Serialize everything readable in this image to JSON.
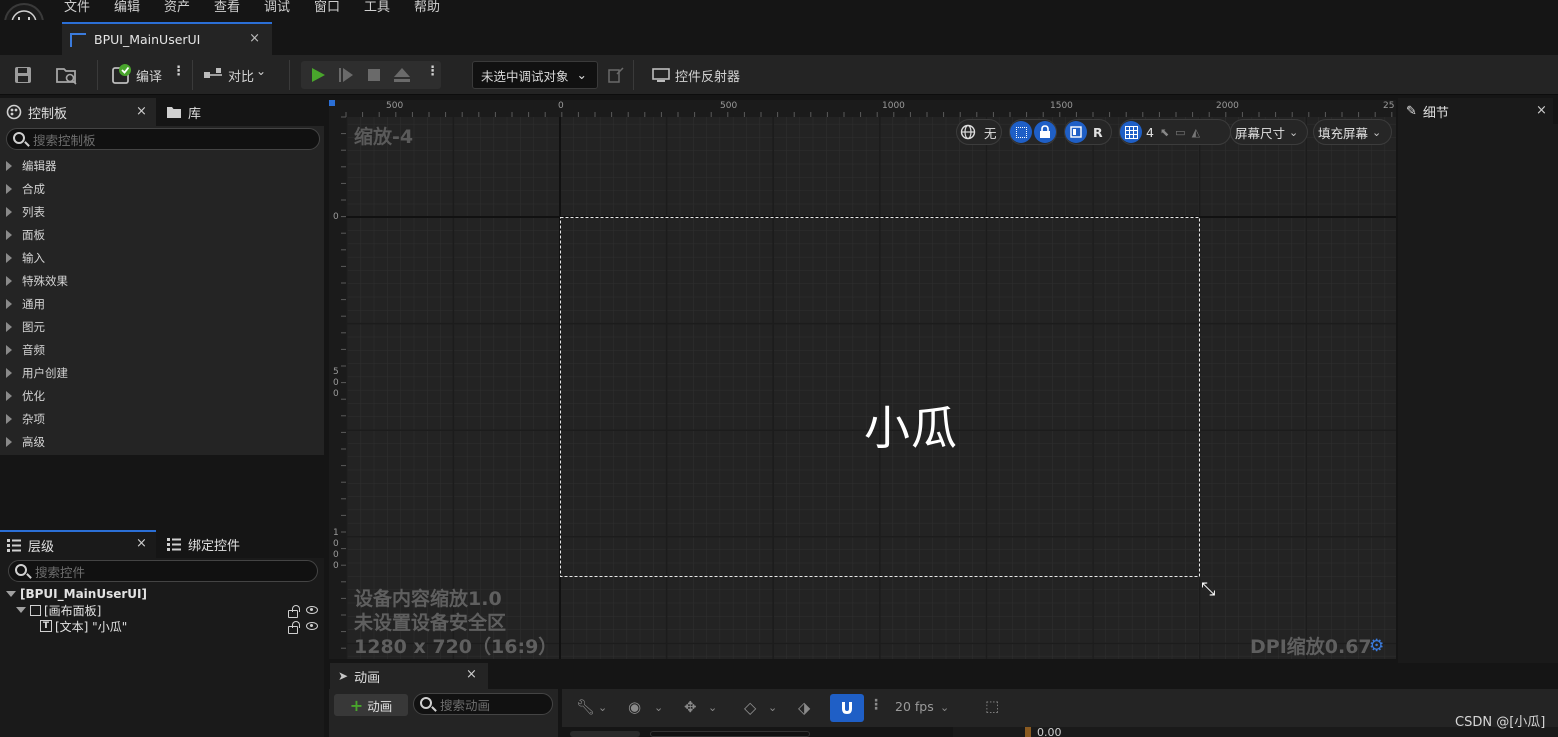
{
  "menu": [
    "文件",
    "编辑",
    "资产",
    "查看",
    "调试",
    "窗口",
    "工具",
    "帮助"
  ],
  "tab": {
    "title": "BPUI_MainUserUI",
    "close": "×"
  },
  "toolbar": {
    "compile_label": "编译",
    "diff_label": "对比",
    "debug_target": "未选中调试对象",
    "widget_reflector": "控件反射器"
  },
  "palette": {
    "tab_label": "控制板",
    "library_tab": "库",
    "close": "×",
    "search_placeholder": "搜索控制板",
    "categories": [
      "编辑器",
      "合成",
      "列表",
      "面板",
      "输入",
      "特殊效果",
      "通用",
      "图元",
      "音频",
      "用户创建",
      "优化",
      "杂项",
      "高级"
    ]
  },
  "hierarchy": {
    "tab_label": "层级",
    "bind_tab": "绑定控件",
    "close": "×",
    "search_placeholder": "搜索控件",
    "root": "[BPUI_MainUserUI]",
    "canvas_panel": "[画布面板]",
    "text_item": "[文本] \"小瓜\""
  },
  "canvas": {
    "zoom": "缩放-4",
    "text": "小瓜",
    "device_scale": "设备内容缩放1.0",
    "safe_zone": "未设置设备安全区",
    "resolution": "1280 x 720（16:9）",
    "dpi": "DPI缩放0.67",
    "ruler_h": [
      "500",
      "0",
      "500",
      "1000",
      "1500",
      "2000",
      "25"
    ],
    "ruler_v_labels": [
      "0",
      "5",
      "0",
      "0",
      "1",
      "0",
      "0",
      "0"
    ],
    "toolbar": {
      "none_label": "无",
      "r_label": "R",
      "grid_num": "4",
      "screen_size": "屏幕尺寸",
      "fill_screen": "填充屏幕"
    }
  },
  "details": {
    "tab_label": "细节",
    "close": "×"
  },
  "animation": {
    "tab_label": "动画",
    "close": "×",
    "add_button": "动画",
    "search_placeholder": "搜索动画",
    "fps": "20 fps",
    "time": "0.00"
  },
  "watermark": "CSDN @[小瓜]",
  "colors": {
    "accent": "#1f5fc6",
    "play_green": "#49a52c",
    "background": "#151515",
    "panel": "#242424"
  }
}
